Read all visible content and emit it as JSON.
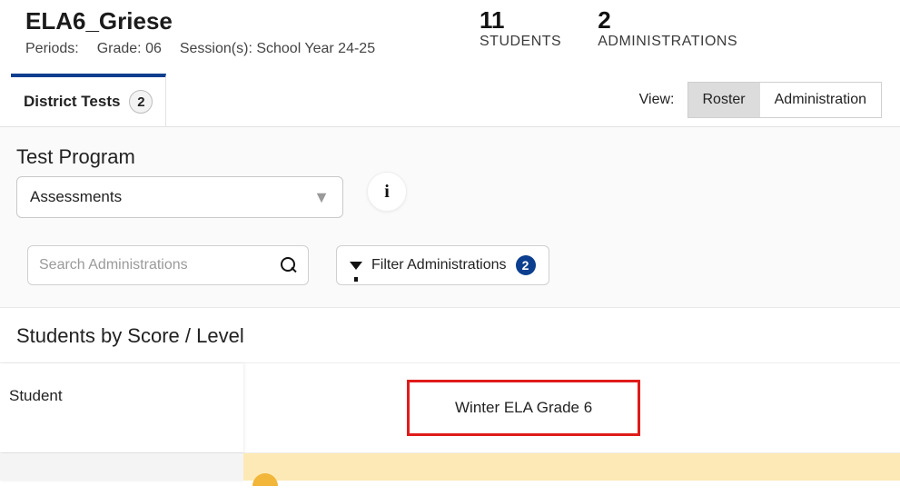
{
  "header": {
    "class_title": "ELA6_Griese",
    "periods_label": "Periods:",
    "grade_label": "Grade: 06",
    "session_label": "Session(s): School Year 24-25",
    "students_count": "11",
    "students_label": "STUDENTS",
    "admins_count": "2",
    "admins_label": "ADMINISTRATIONS"
  },
  "tabs": {
    "district_tests_label": "District Tests",
    "district_tests_count": "2"
  },
  "view": {
    "label": "View:",
    "roster": "Roster",
    "administration": "Administration",
    "active": "roster"
  },
  "filters": {
    "test_program_label": "Test Program",
    "test_program_value": "Assessments",
    "info_icon": "i",
    "search_placeholder": "Search Administrations",
    "filter_button_label": "Filter Administrations",
    "filter_count": "2"
  },
  "students_section": {
    "title": "Students by Score / Level",
    "student_col": "Student",
    "assessment_col": "Winter ELA Grade 6"
  }
}
